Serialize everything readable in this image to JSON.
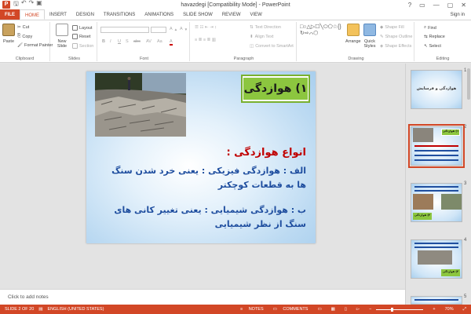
{
  "window": {
    "title": "havazdegi [Compatibility Mode] - PowerPoint",
    "app_icon": "P",
    "qat": [
      "save-icon",
      "undo-icon",
      "redo-icon",
      "start-presentation-icon"
    ],
    "controls": [
      "?",
      "▭",
      "—",
      "▢",
      "✕"
    ]
  },
  "tabs": [
    "FILE",
    "HOME",
    "INSERT",
    "DESIGN",
    "TRANSITIONS",
    "ANIMATIONS",
    "SLIDE SHOW",
    "REVIEW",
    "VIEW"
  ],
  "active_tab": "HOME",
  "signin": "Sign in",
  "ribbon": {
    "clipboard": {
      "paste": "Paste",
      "cut": "Cut",
      "copy": "Copy",
      "format_painter": "Format Painter",
      "label": "Clipboard"
    },
    "slides": {
      "new_slide": "New Slide",
      "layout": "Layout",
      "reset": "Reset",
      "section": "Section",
      "label": "Slides"
    },
    "font": {
      "label": "Font",
      "bold": "B",
      "italic": "I",
      "underline": "U",
      "strike": "S",
      "shadow": "abc",
      "spacing": "AV",
      "case": "Aa",
      "color": "A"
    },
    "paragraph": {
      "text_direction": "Text Direction",
      "align_text": "Align Text",
      "convert_smartart": "Convert to SmartArt",
      "label": "Paragraph"
    },
    "drawing": {
      "arrange": "Arrange",
      "quick_styles": "Quick Styles",
      "shape_fill": "Shape Fill",
      "shape_outline": "Shape Outline",
      "shape_effects": "Shape Effects",
      "label": "Drawing"
    },
    "editing": {
      "find": "Find",
      "replace": "Replace",
      "select": "Select",
      "label": "Editing"
    }
  },
  "slide": {
    "title": "۱) هوازدگی",
    "heading": "انواع هوازدگی :",
    "line_a": "الف : هوازدگی فیزیکی : یعنی خرد شدن سنگ ها به قطعات کوچکتر",
    "line_b": "ب : هوازدگی شیمیایی : یعنی تغییر کانی های سنگ از نظر شیمیایی"
  },
  "notes_placeholder": "Click to add notes",
  "thumbnails": [
    {
      "number": "1",
      "text": "هوازدگی و فرسایش"
    },
    {
      "number": "2",
      "text": "۱) هوازدگی"
    },
    {
      "number": "3",
      "text": "۲) هوازدگی"
    },
    {
      "number": "4",
      "text": "۳) هوازدگی"
    },
    {
      "number": "5",
      "text": ""
    }
  ],
  "status": {
    "slide_info": "SLIDE 2 OF 20",
    "language": "ENGLISH (UNITED STATES)",
    "notes": "NOTES",
    "comments": "COMMENTS",
    "zoom": "70%",
    "zoom_fraction": 0.7
  },
  "colors": {
    "accent": "#d24726",
    "title_box": "#8cc63f",
    "heading": "#c00000",
    "body": "#1f4e9f"
  }
}
